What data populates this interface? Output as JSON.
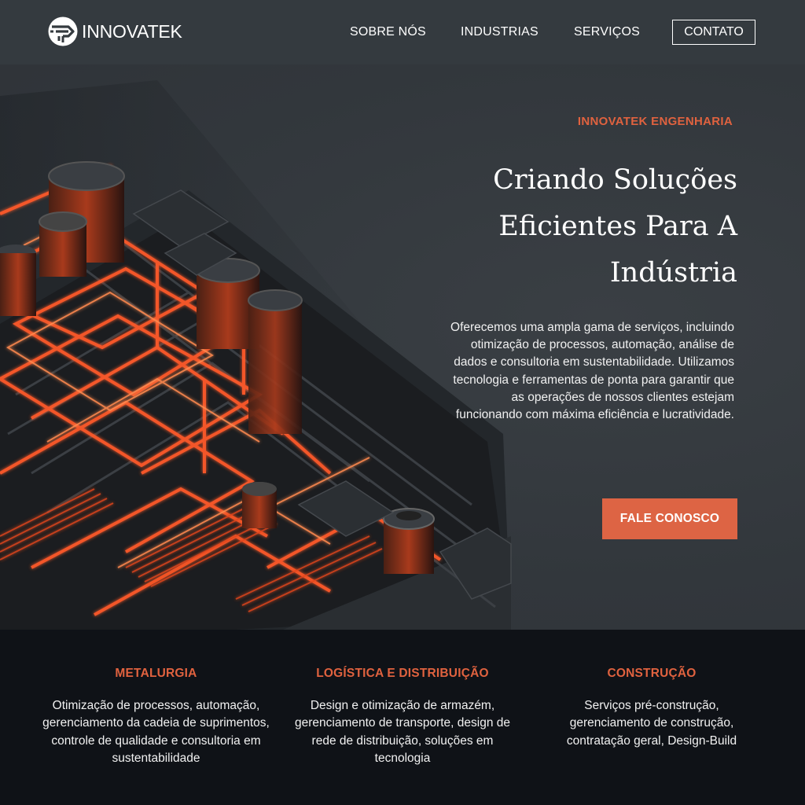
{
  "header": {
    "brand": "INNOVATEK",
    "nav": [
      {
        "label": "SOBRE NÓS"
      },
      {
        "label": "INDUSTRIAS"
      },
      {
        "label": "SERVIÇOS"
      },
      {
        "label": "CONTATO"
      }
    ]
  },
  "hero": {
    "eyebrow": "INNOVATEK ENGENHARIA",
    "title": "Criando Soluções Eficientes Para A Indústria",
    "description": "Oferecemos uma ampla gama de serviços, incluindo otimização de processos, automação, análise de dados e consultoria em sustentabilidade. Utilizamos tecnologia e ferramentas de ponta para garantir que as operações de nossos clientes estejam funcionando com máxima eficiência e lucratividade.",
    "cta_label": "FALE CONOSCO"
  },
  "services": [
    {
      "title": "METALURGIA",
      "text": "Otimização de processos, automação, gerenciamento da cadeia de suprimentos, controle de qualidade e consultoria em sustentabilidade"
    },
    {
      "title": "LOGÍSTICA E DISTRIBUIÇÃO",
      "text": "Design e otimização de armazém, gerenciamento de transporte, design de rede de distribuição, soluções em tecnologia"
    },
    {
      "title": "CONSTRUÇÃO",
      "text": "Serviços pré-construção, gerenciamento de construção, contratação geral, Design-Build"
    }
  ],
  "colors": {
    "accent": "#dd6444",
    "header_bg": "#343a3f",
    "footer_bg": "#0f1217",
    "glow": "#ff5a2a"
  },
  "icons": {
    "logo": "innovatek-logo-icon"
  }
}
